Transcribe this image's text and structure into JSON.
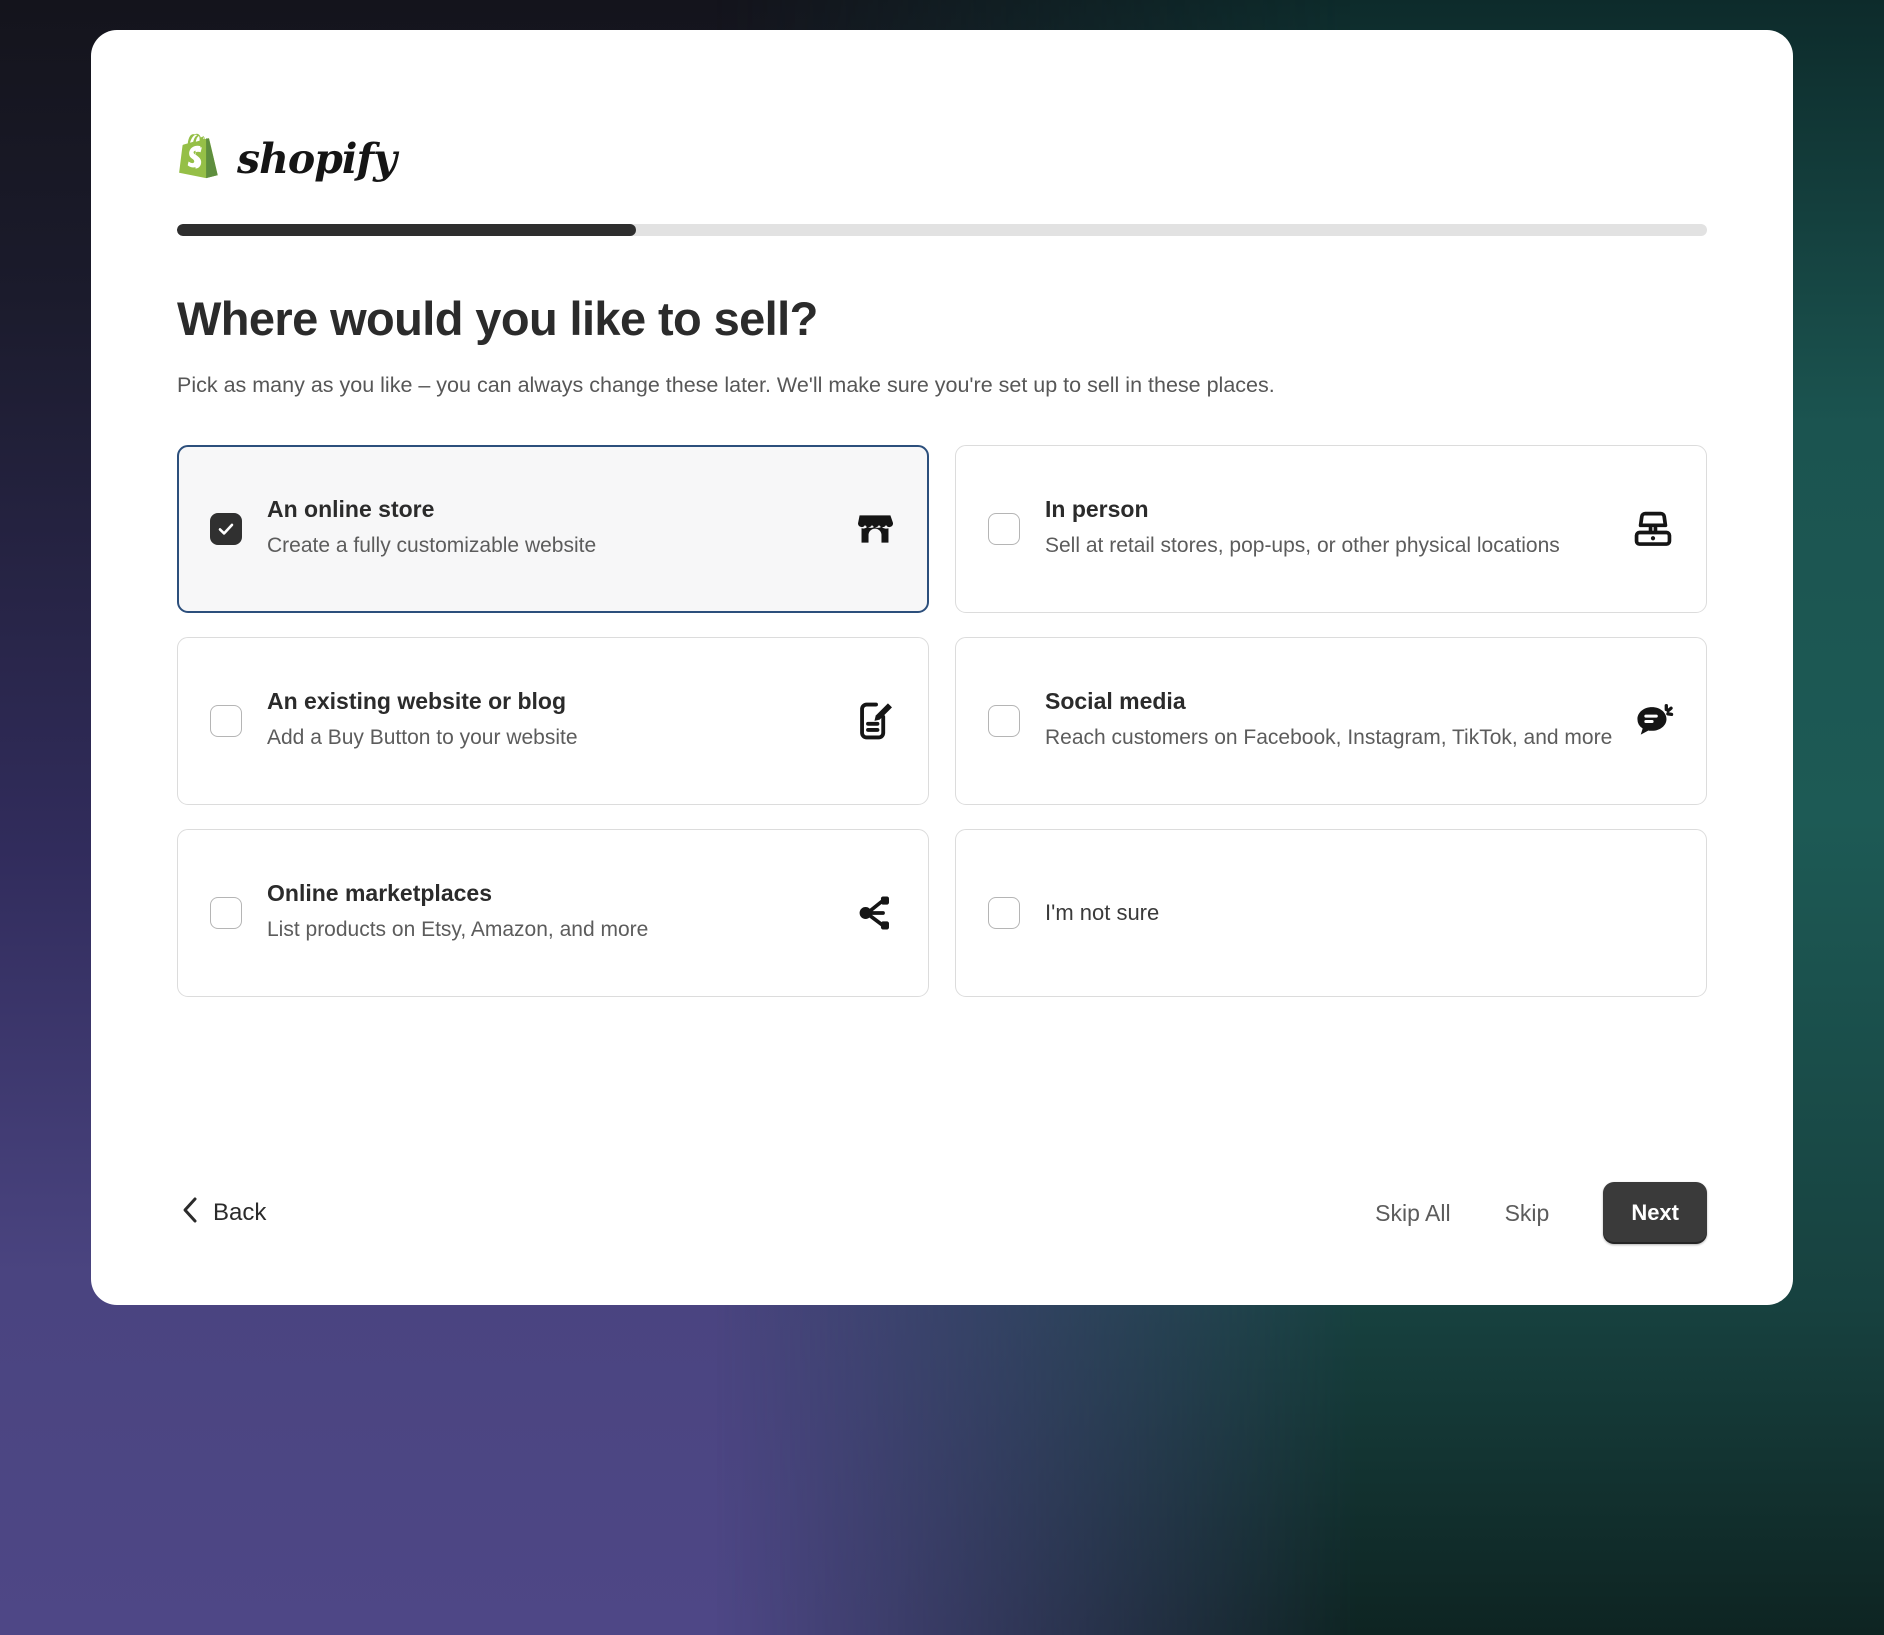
{
  "background": {
    "left_color": "#4a4480",
    "right_color": "#1d5450",
    "top_color": "#14141c"
  },
  "brand": {
    "name": "shopify",
    "logo_icon": "shopify-bag-icon",
    "logo_color": "#95BF47"
  },
  "progress": {
    "percent": 30,
    "fill_color": "#2e2e2e",
    "track_color": "#e2e2e2"
  },
  "heading": {
    "title": "Where would you like to sell?",
    "subtitle": "Pick as many as you like – you can always change these later. We'll make sure you're set up to sell in these places."
  },
  "options": [
    {
      "id": "online-store",
      "title": "An online store",
      "description": "Create a fully customizable website",
      "checked": true,
      "icon": "storefront-icon"
    },
    {
      "id": "in-person",
      "title": "In person",
      "description": "Sell at retail stores, pop-ups, or other physical locations",
      "checked": false,
      "icon": "pos-terminal-icon"
    },
    {
      "id": "existing-website",
      "title": "An existing website or blog",
      "description": "Add a Buy Button to your website",
      "checked": false,
      "icon": "note-edit-icon"
    },
    {
      "id": "social-media",
      "title": "Social media",
      "description": "Reach customers on Facebook, Instagram, TikTok, and more",
      "checked": false,
      "icon": "chat-bubble-icon"
    },
    {
      "id": "online-marketplaces",
      "title": "Online marketplaces",
      "description": "List products on Etsy, Amazon, and more",
      "checked": false,
      "icon": "network-nodes-icon"
    },
    {
      "id": "not-sure",
      "title": "I'm not sure",
      "description": "",
      "checked": false,
      "icon": ""
    }
  ],
  "footer": {
    "back_label": "Back",
    "skip_all_label": "Skip All",
    "skip_label": "Skip",
    "next_label": "Next",
    "next_bg": "#3a3a3a"
  }
}
